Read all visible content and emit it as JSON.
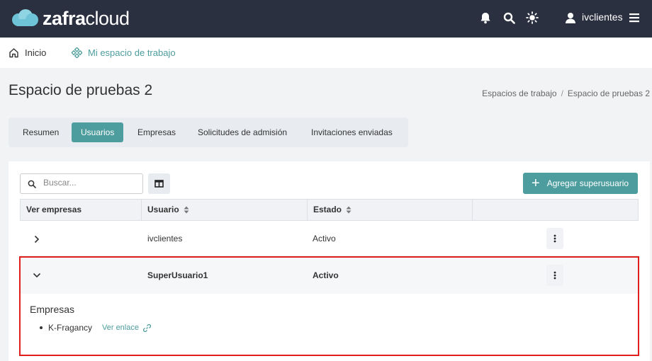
{
  "brand": {
    "name_bold": "zafra",
    "name_light": "cloud"
  },
  "header": {
    "icons": [
      "bell-icon",
      "search-icon",
      "sun-icon",
      "user-icon",
      "menu-icon"
    ],
    "user_name": "ivclientes"
  },
  "nav": {
    "home_label": "Inicio",
    "workspace_label": "Mi espacio de trabajo"
  },
  "page": {
    "title": "Espacio de pruebas 2",
    "breadcrumb": [
      "Espacios de trabajo",
      "/",
      "Espacio de pruebas 2"
    ]
  },
  "tabs": [
    {
      "label": "Resumen",
      "active": false
    },
    {
      "label": "Usuarios",
      "active": true
    },
    {
      "label": "Empresas",
      "active": false
    },
    {
      "label": "Solicitudes de admisión",
      "active": false
    },
    {
      "label": "Invitaciones enviadas",
      "active": false
    }
  ],
  "toolbar": {
    "search_placeholder": "Buscar...",
    "add_label": "Agregar superusuario"
  },
  "table": {
    "headers": [
      "Ver empresas",
      "Usuario",
      "Estado",
      ""
    ],
    "rows": [
      {
        "usuario": "ivclientes",
        "estado": "Activo",
        "expanded": false
      },
      {
        "usuario": "SuperUsuario1",
        "estado": "Activo",
        "expanded": true
      }
    ]
  },
  "expanded": {
    "title": "Empresas",
    "companies": [
      {
        "name": "K-Fragancy",
        "link_label": "Ver enlace"
      }
    ]
  },
  "colors": {
    "topbar": "#2b3040",
    "accent": "#4e9d9e",
    "highlight": "#e01e1e"
  }
}
